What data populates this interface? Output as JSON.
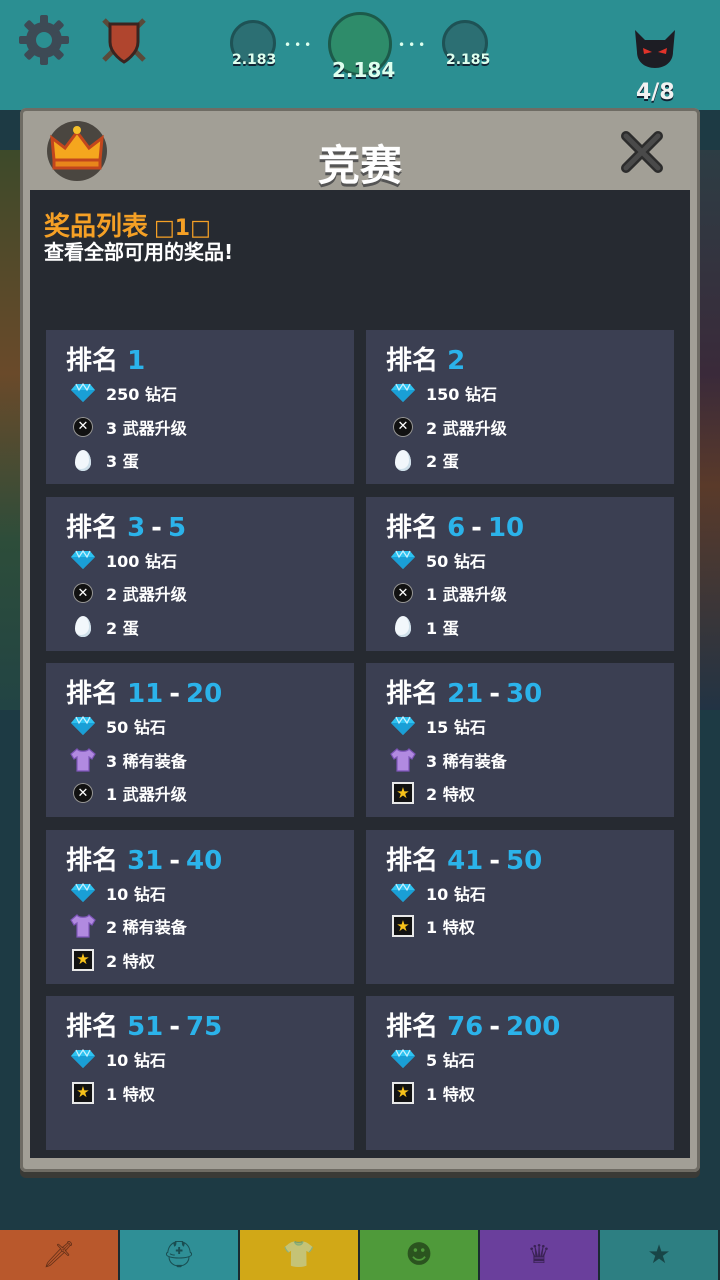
{
  "hud": {
    "levels": [
      {
        "label": "2.183"
      },
      {
        "label": "2.184"
      },
      {
        "label": "2.185"
      }
    ],
    "boss_count": "4/8"
  },
  "modal": {
    "title": "竞赛",
    "header": {
      "title": "奖品列表",
      "tag": "□1□",
      "subtitle": "查看全部可用的奖品!"
    },
    "rank_word": "排名",
    "cards": [
      {
        "from": "1",
        "to": "",
        "rewards": [
          {
            "icon": "diamond-icon",
            "text": "250 钻石"
          },
          {
            "icon": "weapon-upgrade-icon",
            "text": "3 武器升级"
          },
          {
            "icon": "egg-icon",
            "text": "3 蛋"
          }
        ]
      },
      {
        "from": "2",
        "to": "",
        "rewards": [
          {
            "icon": "diamond-icon",
            "text": "150 钻石"
          },
          {
            "icon": "weapon-upgrade-icon",
            "text": "2 武器升级"
          },
          {
            "icon": "egg-icon",
            "text": "2 蛋"
          }
        ]
      },
      {
        "from": "3",
        "to": "5",
        "rewards": [
          {
            "icon": "diamond-icon",
            "text": "100 钻石"
          },
          {
            "icon": "weapon-upgrade-icon",
            "text": "2 武器升级"
          },
          {
            "icon": "egg-icon",
            "text": "2 蛋"
          }
        ]
      },
      {
        "from": "6",
        "to": "10",
        "rewards": [
          {
            "icon": "diamond-icon",
            "text": "50 钻石"
          },
          {
            "icon": "weapon-upgrade-icon",
            "text": "1 武器升级"
          },
          {
            "icon": "egg-icon",
            "text": "1 蛋"
          }
        ]
      },
      {
        "from": "11",
        "to": "20",
        "rewards": [
          {
            "icon": "diamond-icon",
            "text": "50 钻石"
          },
          {
            "icon": "rare-gear-icon",
            "text": "3 稀有装备"
          },
          {
            "icon": "weapon-upgrade-icon",
            "text": "1 武器升级"
          }
        ]
      },
      {
        "from": "21",
        "to": "30",
        "rewards": [
          {
            "icon": "diamond-icon",
            "text": "15 钻石"
          },
          {
            "icon": "rare-gear-icon",
            "text": "3 稀有装备"
          },
          {
            "icon": "privilege-star-icon",
            "text": "2 特权"
          }
        ]
      },
      {
        "from": "31",
        "to": "40",
        "rewards": [
          {
            "icon": "diamond-icon",
            "text": "10 钻石"
          },
          {
            "icon": "rare-gear-icon",
            "text": "2 稀有装备"
          },
          {
            "icon": "privilege-star-icon",
            "text": "2 特权"
          }
        ]
      },
      {
        "from": "41",
        "to": "50",
        "rewards": [
          {
            "icon": "diamond-icon",
            "text": "10 钻石"
          },
          {
            "icon": "privilege-star-icon",
            "text": "1 特权"
          }
        ]
      },
      {
        "from": "51",
        "to": "75",
        "rewards": [
          {
            "icon": "diamond-icon",
            "text": "10 钻石"
          },
          {
            "icon": "privilege-star-icon",
            "text": "1 特权"
          }
        ]
      },
      {
        "from": "76",
        "to": "200",
        "rewards": [
          {
            "icon": "diamond-icon",
            "text": "5 钻石"
          },
          {
            "icon": "privilege-star-icon",
            "text": "1 特权"
          }
        ]
      }
    ]
  },
  "bottom_tabs": [
    {
      "icon": "sword-icon",
      "color": "#b9582c"
    },
    {
      "icon": "viking-helmet-icon",
      "color": "#2f8f96"
    },
    {
      "icon": "armor-shirt-icon",
      "color": "#d1a817"
    },
    {
      "icon": "monster-icon",
      "color": "#4f9a3a"
    },
    {
      "icon": "boss-icon",
      "color": "#6a3f9c"
    },
    {
      "icon": "star-icon",
      "color": "#2d7f82"
    }
  ],
  "colors": {
    "rank_number": "#2bb3ea",
    "header_title": "#f5a025",
    "card_bg": "#3b3f52",
    "panel_bg": "#262a31",
    "modal_frame": "#a29f96"
  }
}
